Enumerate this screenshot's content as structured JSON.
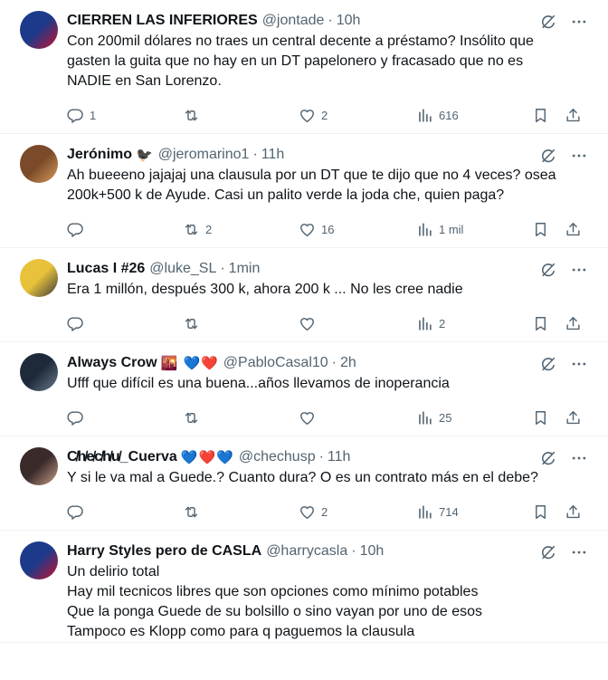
{
  "tweets": [
    {
      "name": "CIERREN LAS INFERIORES",
      "emojis": "",
      "handle": "@jontade",
      "dot": "·",
      "time": "10h",
      "lines": [
        "Con 200mil dólares no traes un central decente a préstamo? Insólito que",
        "gasten la guita que no hay en un DT papelonero y fracasado que no es",
        "NADIE en San Lorenzo."
      ],
      "replies": "1",
      "retweets": "",
      "likes": "2",
      "views": "616",
      "avatar_colors": [
        "#1d3a8a",
        "#c8102e"
      ]
    },
    {
      "name": "Jerónimo",
      "emojis": "🐦‍⬛",
      "handle": "@jeromarino1",
      "dot": "·",
      "time": "11h",
      "lines": [
        "Ah bueeeno jajajaj una clausula por un DT que te dijo que no 4 veces? osea",
        "200k+500 k de Ayude. Casi un palito verde la joda che, quien paga?"
      ],
      "replies": "",
      "retweets": "2",
      "likes": "16",
      "views": "1 mil",
      "avatar_colors": [
        "#7a4a2a",
        "#d99a5b"
      ]
    },
    {
      "name": "Lucas I #26",
      "emojis": "",
      "handle": "@luke_SL",
      "dot": "·",
      "time": "1min",
      "lines": [
        "Era 1 millón, después 300 k, ahora 200 k ... No les cree nadie"
      ],
      "replies": "",
      "retweets": "",
      "likes": "",
      "views": "2",
      "avatar_colors": [
        "#e8c23a",
        "#3a3a3a"
      ]
    },
    {
      "name": "Always Crow",
      "emojis": "🌇 💙❤️",
      "handle": "@PabloCasal10",
      "dot": "·",
      "time": "2h",
      "lines": [
        "Ufff que difícil es una buena...años llevamos de inoperancia"
      ],
      "replies": "",
      "retweets": "",
      "likes": "",
      "views": "25",
      "avatar_colors": [
        "#1e2a3a",
        "#6a7a8a"
      ]
    },
    {
      "name": "C̸h̸e̸c̸h̸u̸_Cuerva",
      "emojis": "💙❤️💙",
      "handle": "@chechusp",
      "dot": "·",
      "time": "11h",
      "lines": [
        "Y si le va mal a Guede.? Cuanto dura? O es un contrato más en el debe?"
      ],
      "replies": "",
      "retweets": "",
      "likes": "2",
      "views": "714",
      "avatar_colors": [
        "#3a2a2a",
        "#c9a08a"
      ]
    },
    {
      "name": "Harry Styles pero de CASLA",
      "emojis": "",
      "handle": "@harrycasla",
      "dot": "·",
      "time": "10h",
      "lines": [
        "Un delirio total",
        "Hay mil tecnicos libres que son opciones como mínimo potables",
        "Que la ponga Guede de su bolsillo o sino vayan por uno de esos",
        "Tampoco es Klopp como para q paguemos la clausula"
      ],
      "replies": "",
      "retweets": "",
      "likes": "",
      "views": "",
      "avatar_colors": [
        "#1d3a8a",
        "#c8102e"
      ]
    }
  ]
}
